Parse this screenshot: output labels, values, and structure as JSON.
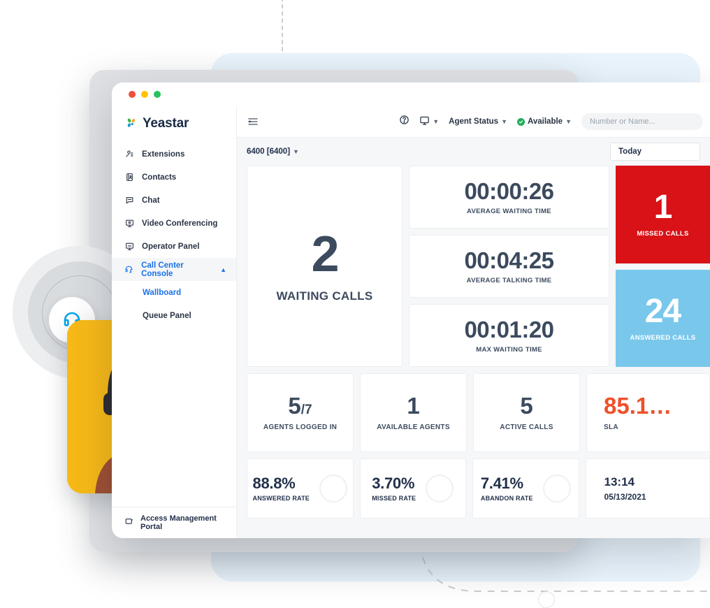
{
  "window": {
    "traffic_lights": [
      "red",
      "yellow",
      "green"
    ]
  },
  "brand": {
    "name": "Yeastar",
    "logo_colors": {
      "green": "#3cb54a",
      "yellow": "#f5a623",
      "blue": "#1b9ad6"
    }
  },
  "sidebar": {
    "items": [
      {
        "label": "Extensions",
        "icon": "user-icon",
        "active": false
      },
      {
        "label": "Contacts",
        "icon": "contacts-icon",
        "active": false
      },
      {
        "label": "Chat",
        "icon": "chat-icon",
        "active": false
      },
      {
        "label": "Video Conferencing",
        "icon": "video-icon",
        "active": false
      },
      {
        "label": "Operator Panel",
        "icon": "monitor-icon",
        "active": false
      },
      {
        "label": "Call Center Console",
        "icon": "headset-icon",
        "active": true
      }
    ],
    "subitems": [
      {
        "label": "Wallboard",
        "active": true
      },
      {
        "label": "Queue Panel",
        "active": false
      }
    ],
    "footer": {
      "label": "Access Management Portal",
      "icon": "portal-icon"
    }
  },
  "topbar": {
    "menu_icon": "collapse-menu-icon",
    "help_icon": "help-circle-icon",
    "monitor_icon": "monitor-icon",
    "agent_status_label": "Agent Status",
    "availability_label": "Available",
    "availability_color": "#22ae5b",
    "search_placeholder": "Number or Name...",
    "search_value": ""
  },
  "subbar": {
    "queue_selector": "6400 [6400]",
    "date_filter": "Today"
  },
  "wallboard": {
    "waiting_calls": {
      "value": "2",
      "label": "WAITING CALLS"
    },
    "times": [
      {
        "value": "00:00:26",
        "label": "AVERAGE WAITING TIME"
      },
      {
        "value": "00:04:25",
        "label": "AVERAGE TALKING TIME"
      },
      {
        "value": "00:01:20",
        "label": "MAX WAITING TIME"
      }
    ],
    "color_cards": [
      {
        "value": "1",
        "label": "MISSED CALLS",
        "color": "#d81217"
      },
      {
        "value": "24",
        "label": "ANSWERED CALLS",
        "color": "#79c8ec"
      }
    ],
    "kpis": [
      {
        "value": "5",
        "suffix": "/7",
        "label": "AGENTS LOGGED IN",
        "warn": false
      },
      {
        "value": "1",
        "suffix": "",
        "label": "AVAILABLE AGENTS",
        "warn": false
      },
      {
        "value": "5",
        "suffix": "",
        "label": "ACTIVE CALLS",
        "warn": false
      },
      {
        "value": "85.1…",
        "suffix": "",
        "label": "SLA",
        "warn": true
      }
    ],
    "rates": [
      {
        "value": "88.8%",
        "label": "ANSWERED RATE"
      },
      {
        "value": "3.70%",
        "label": "MISSED RATE"
      },
      {
        "value": "7.41%",
        "label": "ABANDON RATE"
      }
    ],
    "clock": {
      "time": "13:14",
      "date": "05/13/2021"
    }
  }
}
